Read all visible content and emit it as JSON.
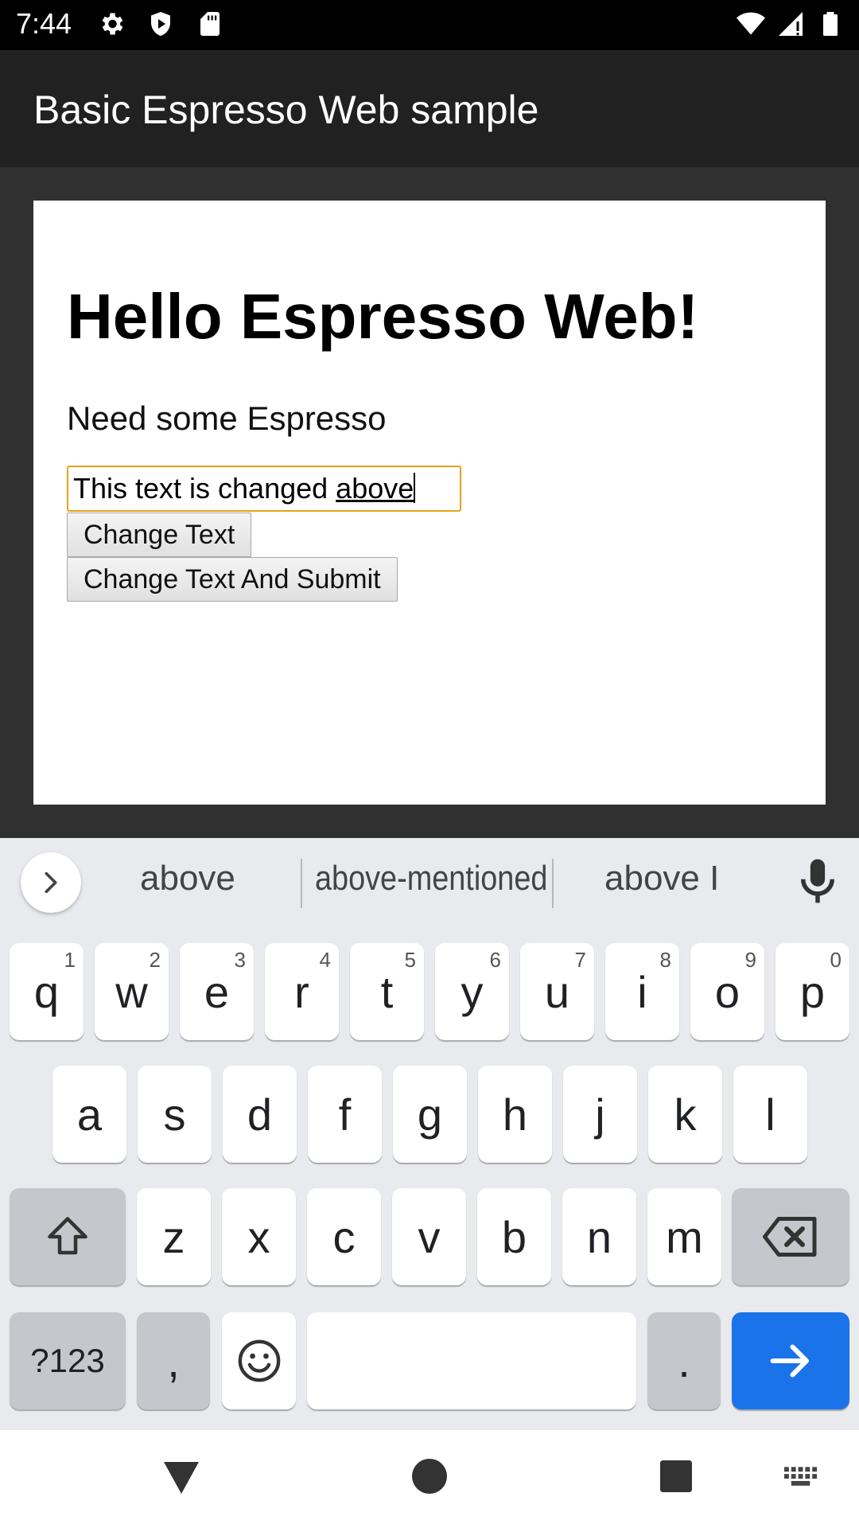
{
  "status_bar": {
    "time": "7:44",
    "left_icons": [
      "settings-icon",
      "play-protect-icon",
      "sd-card-icon"
    ],
    "right_icons": [
      "wifi-icon",
      "signal-icon",
      "battery-icon"
    ]
  },
  "app_bar": {
    "title": "Basic Espresso Web sample"
  },
  "web_page": {
    "heading": "Hello Espresso Web!",
    "paragraph": "Need some Espresso",
    "input": {
      "value_prefix": "This text is changed ",
      "value_composing": "above"
    },
    "buttons": {
      "change_text": "Change Text",
      "change_text_submit": "Change Text And Submit"
    }
  },
  "keyboard": {
    "suggestions": [
      "above",
      "above-mentioned",
      "above I"
    ],
    "row1": [
      {
        "label": "q",
        "hint": "1"
      },
      {
        "label": "w",
        "hint": "2"
      },
      {
        "label": "e",
        "hint": "3"
      },
      {
        "label": "r",
        "hint": "4"
      },
      {
        "label": "t",
        "hint": "5"
      },
      {
        "label": "y",
        "hint": "6"
      },
      {
        "label": "u",
        "hint": "7"
      },
      {
        "label": "i",
        "hint": "8"
      },
      {
        "label": "o",
        "hint": "9"
      },
      {
        "label": "p",
        "hint": "0"
      }
    ],
    "row2": [
      "a",
      "s",
      "d",
      "f",
      "g",
      "h",
      "j",
      "k",
      "l"
    ],
    "row3": [
      "z",
      "x",
      "c",
      "v",
      "b",
      "n",
      "m"
    ],
    "symbols_label": "?123",
    "comma_label": ",",
    "period_label": ".",
    "icons": {
      "expand": "chevron-right-icon",
      "mic": "mic-icon",
      "shift": "shift-icon",
      "backspace": "backspace-icon",
      "emoji": "emoji-icon",
      "enter": "arrow-right-icon"
    },
    "accent_color": "#1a73e8"
  },
  "nav_bar": {
    "icons": [
      "back-icon",
      "home-icon",
      "recents-icon",
      "keyboard-switch-icon"
    ]
  }
}
